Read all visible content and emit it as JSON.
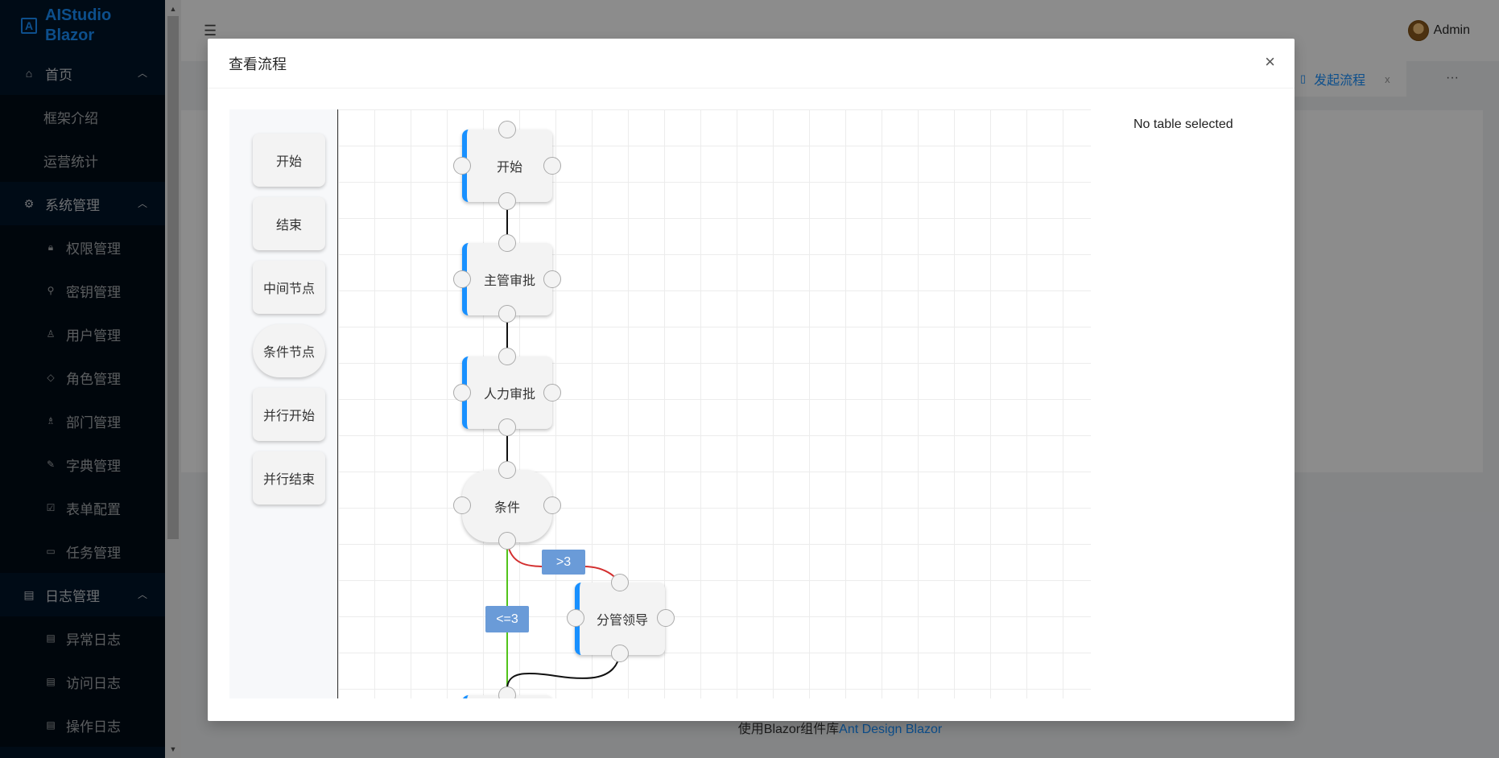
{
  "app": {
    "logo_text": "AIStudio Blazor",
    "logo_letter": "A"
  },
  "sidebar": {
    "groups": [
      {
        "label": "首页",
        "icon": "home-icon",
        "items": [
          {
            "label": "框架介绍"
          },
          {
            "label": "运营统计"
          }
        ]
      },
      {
        "label": "系统管理",
        "icon": "gear-icon",
        "items": [
          {
            "label": "权限管理",
            "icon": "lock-icon"
          },
          {
            "label": "密钥管理",
            "icon": "key-icon"
          },
          {
            "label": "用户管理",
            "icon": "user-icon"
          },
          {
            "label": "角色管理",
            "icon": "shield-icon"
          },
          {
            "label": "部门管理",
            "icon": "team-icon"
          },
          {
            "label": "字典管理",
            "icon": "edit-icon"
          },
          {
            "label": "表单配置",
            "icon": "form-icon"
          },
          {
            "label": "任务管理",
            "icon": "calendar-icon"
          }
        ]
      },
      {
        "label": "日志管理",
        "icon": "log-icon",
        "items": [
          {
            "label": "异常日志",
            "icon": "file-icon"
          },
          {
            "label": "访问日志",
            "icon": "file-icon"
          },
          {
            "label": "操作日志",
            "icon": "file-icon"
          }
        ]
      }
    ]
  },
  "header": {
    "user_name": "Admin"
  },
  "tabs": [
    {
      "label": "发起流程",
      "close": "x"
    }
  ],
  "tabs_more": "···",
  "footer": {
    "text": "使用Blazor组件库",
    "link": "Ant Design Blazor"
  },
  "modal": {
    "title": "查看流程",
    "close": "×",
    "palette": [
      "开始",
      "结束",
      "中间节点",
      "条件节点",
      "并行开始",
      "并行结束"
    ],
    "nodes": [
      {
        "id": "start",
        "label": "开始",
        "type": "task"
      },
      {
        "id": "manager",
        "label": "主管审批",
        "type": "task"
      },
      {
        "id": "hr",
        "label": "人力审批",
        "type": "task"
      },
      {
        "id": "condition",
        "label": "条件",
        "type": "condition"
      },
      {
        "id": "leader",
        "label": "分管领导",
        "type": "task"
      }
    ],
    "edge_labels": [
      ">3",
      "<=3"
    ],
    "colors": {
      "edge_gt": "#d32f2f",
      "edge_le": "#52c41a",
      "edge_default": "#111111",
      "node_accent": "#1890ff"
    },
    "properties_empty": "No table selected"
  }
}
